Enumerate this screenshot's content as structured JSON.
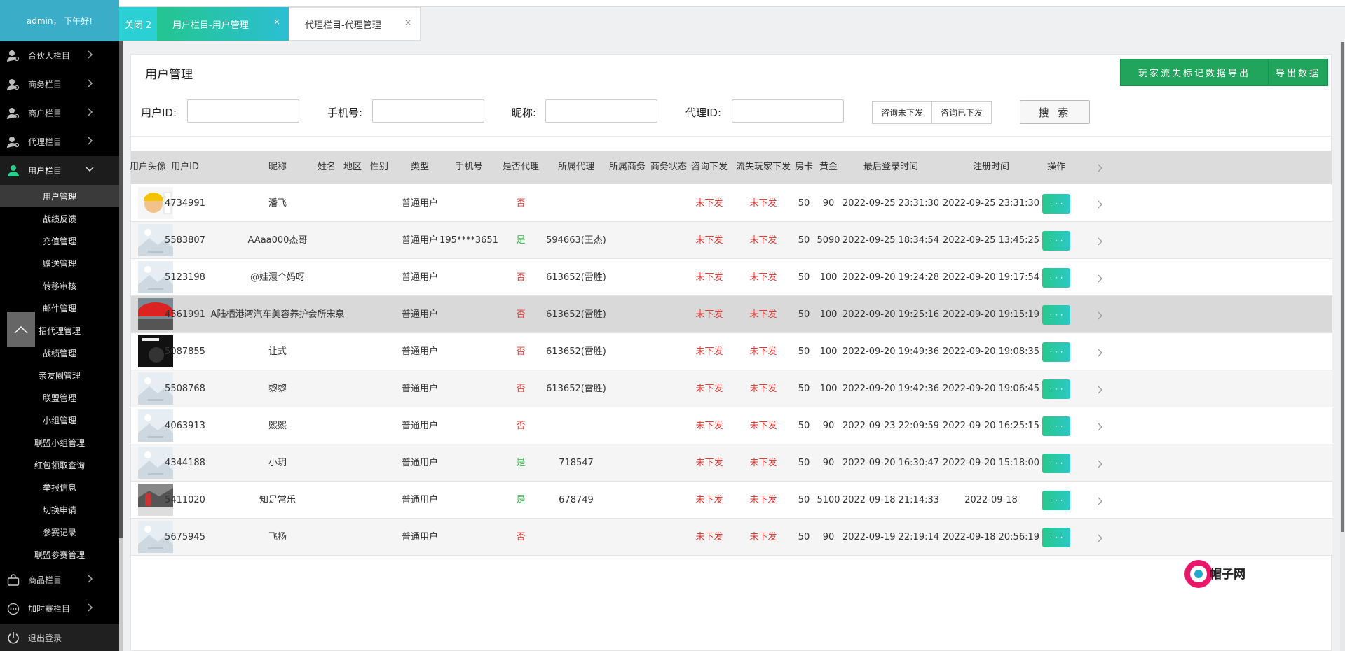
{
  "sidebar": {
    "greeting": "admin， 下午好!",
    "menus": [
      {
        "label": "合伙人栏目",
        "icon": "user-icon"
      },
      {
        "label": "商务栏目",
        "icon": "user-icon"
      },
      {
        "label": "商户栏目",
        "icon": "user-icon"
      },
      {
        "label": "代理栏目",
        "icon": "user-icon"
      },
      {
        "label": "用户栏目",
        "icon": "user-icon"
      }
    ],
    "sub_items": [
      "用户管理",
      "战绩反馈",
      "充值管理",
      "赠送管理",
      "转移审核",
      "邮件管理",
      "招代理管理",
      "战绩管理",
      "亲友圈管理",
      "联盟管理",
      "小组管理",
      "联盟小组管理",
      "红包领取查询",
      "举报信息",
      "切换申请",
      "参赛记录",
      "联盟参赛管理"
    ],
    "bottom_menus": [
      {
        "label": "商品栏目",
        "icon": "bag-icon"
      },
      {
        "label": "加时赛栏目",
        "icon": "dots-circle-icon"
      }
    ],
    "logout": "退出登录"
  },
  "tabs": {
    "close_all": "关闭 2",
    "items": [
      {
        "label": "用户栏目-用户管理",
        "close": "×"
      },
      {
        "label": "代理栏目-代理管理",
        "close": "×"
      }
    ]
  },
  "panel": {
    "title": "用户管理",
    "export_lost_label": "玩家流失标记数据导出",
    "export_label": "导出数据"
  },
  "filters": {
    "user_id_label": "用户ID:",
    "phone_label": "手机号:",
    "nickname_label": "昵称:",
    "agent_id_label": "代理ID:",
    "seg_not_sent": "咨询未下发",
    "seg_sent": "咨询已下发",
    "search_label": "搜 索"
  },
  "table": {
    "headers": [
      "用户头像",
      "用户ID",
      "昵称",
      "姓名",
      "地区",
      "性别",
      "类型",
      "手机号",
      "是否代理",
      "所属代理",
      "所属商务",
      "商务状态",
      "咨询下发",
      "流失玩家下发",
      "房卡",
      "黄金",
      "最后登录时间",
      "注册时间",
      "操作"
    ],
    "op_label": "· · ·",
    "rows": [
      {
        "id": "4734991",
        "nickname": "潘飞",
        "type": "普通用户",
        "phone": "",
        "is_agent": "否",
        "agent": "",
        "consult": "未下发",
        "lost": "未下发",
        "card": "50",
        "gold": "90",
        "last_login": "2022-09-25 23:31:30",
        "register": "2022-09-25 23:31:30",
        "avatar": "cartoon"
      },
      {
        "id": "5583807",
        "nickname": "AAaa000杰哥",
        "type": "普通用户",
        "phone": "195****3651",
        "is_agent": "是",
        "agent": "594663(王杰)",
        "consult": "未下发",
        "lost": "未下发",
        "card": "50",
        "gold": "5090",
        "last_login": "2022-09-25 18:34:54",
        "register": "2022-09-25 13:45:25",
        "avatar": "default"
      },
      {
        "id": "5123198",
        "nickname": "@娃澴个妈呀",
        "type": "普通用户",
        "phone": "",
        "is_agent": "否",
        "agent": "613652(雷胜)",
        "consult": "未下发",
        "lost": "未下发",
        "card": "50",
        "gold": "100",
        "last_login": "2022-09-20 19:24:28",
        "register": "2022-09-20 19:17:54",
        "avatar": "default"
      },
      {
        "id": "4561991",
        "nickname": "A陆栖港湾汽车美容养护会所宋泉",
        "type": "普通用户",
        "phone": "",
        "is_agent": "否",
        "agent": "613652(雷胜)",
        "consult": "未下发",
        "lost": "未下发",
        "card": "50",
        "gold": "100",
        "last_login": "2022-09-20 19:25:16",
        "register": "2022-09-20 19:15:19",
        "avatar": "photo-red"
      },
      {
        "id": "5087855",
        "nickname": "让式",
        "type": "普通用户",
        "phone": "",
        "is_agent": "否",
        "agent": "613652(雷胜)",
        "consult": "未下发",
        "lost": "未下发",
        "card": "50",
        "gold": "100",
        "last_login": "2022-09-20 19:49:36",
        "register": "2022-09-20 19:08:35",
        "avatar": "dark"
      },
      {
        "id": "5508768",
        "nickname": "黎黎",
        "type": "普通用户",
        "phone": "",
        "is_agent": "否",
        "agent": "613652(雷胜)",
        "consult": "未下发",
        "lost": "未下发",
        "card": "50",
        "gold": "100",
        "last_login": "2022-09-20 19:42:36",
        "register": "2022-09-20 19:06:45",
        "avatar": "default"
      },
      {
        "id": "4063913",
        "nickname": "熙熙",
        "type": "普通用户",
        "phone": "",
        "is_agent": "否",
        "agent": "",
        "consult": "未下发",
        "lost": "未下发",
        "card": "50",
        "gold": "90",
        "last_login": "2022-09-23 22:09:59",
        "register": "2022-09-20 16:25:15",
        "avatar": "default"
      },
      {
        "id": "4344188",
        "nickname": "小玥",
        "type": "普通用户",
        "phone": "",
        "is_agent": "是",
        "agent": "718547",
        "consult": "未下发",
        "lost": "未下发",
        "card": "50",
        "gold": "90",
        "last_login": "2022-09-20 16:30:47",
        "register": "2022-09-20 15:18:00",
        "avatar": "default"
      },
      {
        "id": "5411020",
        "nickname": "知足常乐",
        "type": "普通用户",
        "phone": "",
        "is_agent": "是",
        "agent": "678749",
        "consult": "未下发",
        "lost": "未下发",
        "card": "50",
        "gold": "5100",
        "last_login": "2022-09-18 21:14:33",
        "register": "2022-09-18",
        "avatar": "photo-street"
      },
      {
        "id": "5675945",
        "nickname": "飞扬",
        "type": "普通用户",
        "phone": "",
        "is_agent": "否",
        "agent": "",
        "consult": "未下发",
        "lost": "未下发",
        "card": "50",
        "gold": "90",
        "last_login": "2022-09-19 22:19:14",
        "register": "2022-09-18 20:56:19",
        "avatar": "default"
      }
    ]
  },
  "watermark": {
    "text": "帽子网"
  },
  "colors": {
    "accent_green": "#21a55c",
    "status_red": "#e53935",
    "status_green": "#39b54a",
    "header_blue": "#3aaec8"
  }
}
